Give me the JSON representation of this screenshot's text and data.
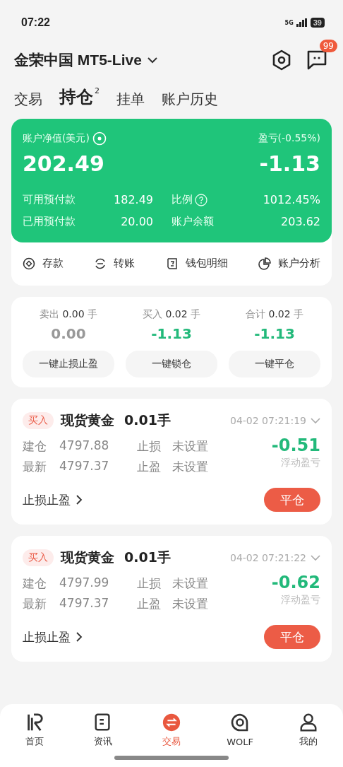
{
  "status_bar": {
    "time": "07:22",
    "network": "5G",
    "battery": "39"
  },
  "header": {
    "account": "金荣中国 MT5-Live",
    "badge": "99"
  },
  "tabs": [
    {
      "label": "交易",
      "selected": false
    },
    {
      "label": "持仓",
      "selected": true,
      "count": "2"
    },
    {
      "label": "挂单",
      "selected": false
    },
    {
      "label": "账户历史",
      "selected": false
    }
  ],
  "account_card": {
    "equity_label": "账户净值(美元)",
    "equity": "202.49",
    "pl_label": "盈亏(-0.55%)",
    "pl": "-1.13",
    "rows": [
      {
        "label": "可用预付款",
        "value": "182.49",
        "label_2": "比例",
        "help": true,
        "value_2": "1012.45%"
      },
      {
        "label": "已用预付款",
        "value": "20.00",
        "label_2": "账户余额",
        "help": false,
        "value_2": "203.62"
      }
    ]
  },
  "actions": [
    {
      "kind": "deposit",
      "label": "存款"
    },
    {
      "kind": "transfer",
      "label": "转账"
    },
    {
      "kind": "wallet",
      "label": "钱包明细"
    },
    {
      "kind": "analysis",
      "label": "账户分析"
    }
  ],
  "summary": [
    {
      "label": "卖出",
      "lots": "0.00",
      "unit": "手",
      "value": "0.00",
      "negative": false,
      "button": "一键止损止盈"
    },
    {
      "label": "买入",
      "lots": "0.02",
      "unit": "手",
      "value": "-1.13",
      "negative": true,
      "button": "一键锁仓"
    },
    {
      "label": "合计",
      "lots": "0.02",
      "unit": "手",
      "value": "-1.13",
      "negative": true,
      "button": "一键平仓"
    }
  ],
  "positions": [
    {
      "side": "买入",
      "symbol": "现货黄金",
      "lots": "0.01手",
      "time": "04-02 07:21:19",
      "open_label": "建仓",
      "open": "4797.88",
      "last_label": "最新",
      "last": "4797.37",
      "sl_label": "止损",
      "sl": "未设置",
      "tp_label": "止盈",
      "tp": "未设置",
      "pl": "-0.51",
      "pl_label": "浮动盈亏",
      "sltp_link": "止损止盈",
      "close": "平仓"
    },
    {
      "side": "买入",
      "symbol": "现货黄金",
      "lots": "0.01手",
      "time": "04-02 07:21:22",
      "open_label": "建仓",
      "open": "4797.99",
      "last_label": "最新",
      "last": "4797.37",
      "sl_label": "止损",
      "sl": "未设置",
      "tp_label": "止盈",
      "tp": "未设置",
      "pl": "-0.62",
      "pl_label": "浮动盈亏",
      "sltp_link": "止损止盈",
      "close": "平仓"
    }
  ],
  "bottom_nav": [
    {
      "kind": "home",
      "label": "首页",
      "selected": false
    },
    {
      "kind": "news",
      "label": "资讯",
      "selected": false
    },
    {
      "kind": "trade",
      "label": "交易",
      "selected": true
    },
    {
      "kind": "wolf",
      "label": "WOLF",
      "selected": false
    },
    {
      "kind": "me",
      "label": "我的",
      "selected": false
    }
  ]
}
